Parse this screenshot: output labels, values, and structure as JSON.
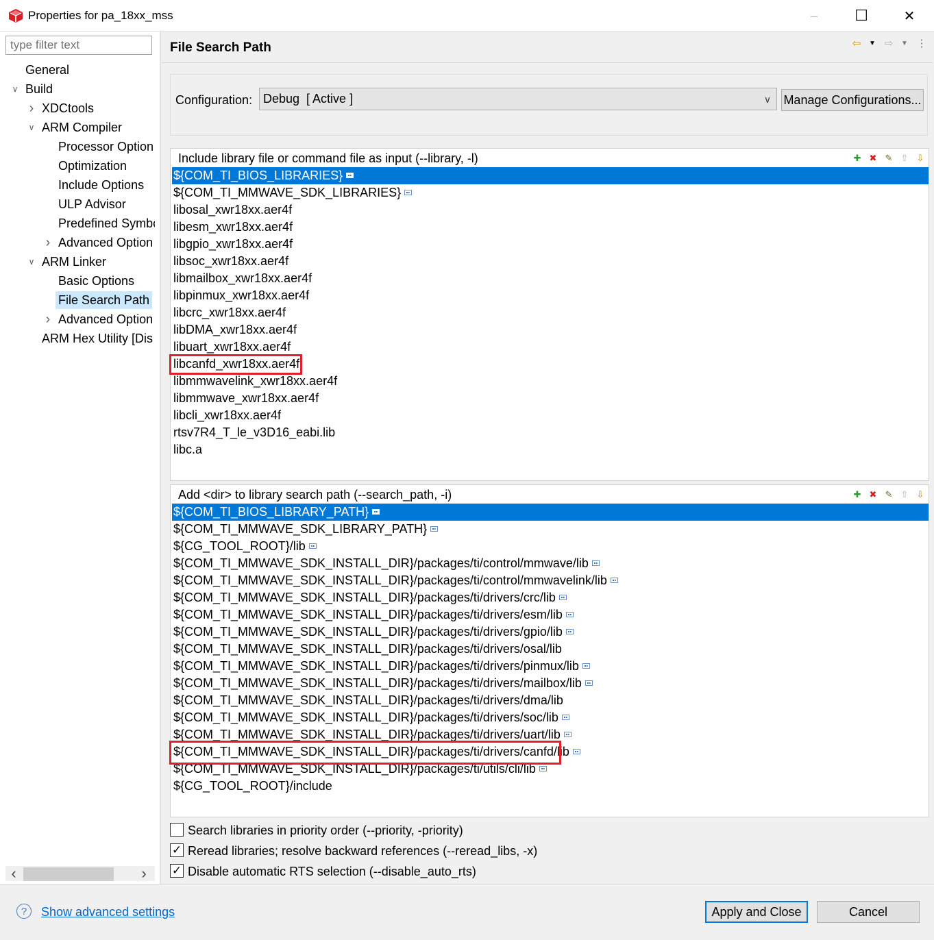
{
  "window": {
    "title": "Properties for pa_18xx_mss",
    "minimize_glyph": "–",
    "maximize_glyph": "☐",
    "close_glyph": "✕"
  },
  "filter": {
    "placeholder": "type filter text"
  },
  "tree": {
    "general": "General",
    "build": "Build",
    "xdctools": "XDCtools",
    "arm_compiler": "ARM Compiler",
    "processor_option": "Processor Option",
    "optimization": "Optimization",
    "include_options": "Include Options",
    "ulp_advisor": "ULP Advisor",
    "predefined_symbols": "Predefined Symbo",
    "advanced_options_compiler": "Advanced Option",
    "arm_linker": "ARM Linker",
    "basic_options": "Basic Options",
    "file_search_path": "File Search Path",
    "advanced_options_linker": "Advanced Option",
    "arm_hex_utility": "ARM Hex Utility  [Dis"
  },
  "page": {
    "title": "File Search Path"
  },
  "configuration": {
    "label": "Configuration:",
    "value": "Debug  [ Active ]",
    "manage_button": "Manage Configurations..."
  },
  "library_list": {
    "header": "Include library file or command file as input (--library, -l)",
    "items": [
      "${COM_TI_BIOS_LIBRARIES}",
      "${COM_TI_MMWAVE_SDK_LIBRARIES}",
      "libosal_xwr18xx.aer4f",
      "libesm_xwr18xx.aer4f",
      "libgpio_xwr18xx.aer4f",
      "libsoc_xwr18xx.aer4f",
      "libmailbox_xwr18xx.aer4f",
      "libpinmux_xwr18xx.aer4f",
      "libcrc_xwr18xx.aer4f",
      "libDMA_xwr18xx.aer4f",
      "libuart_xwr18xx.aer4f",
      "libcanfd_xwr18xx.aer4f",
      "libmmwavelink_xwr18xx.aer4f",
      "libmmwave_xwr18xx.aer4f",
      "libcli_xwr18xx.aer4f",
      "rtsv7R4_T_le_v3D16_eabi.lib",
      "libc.a"
    ]
  },
  "search_path_list": {
    "header": "Add <dir> to library search path (--search_path, -i)",
    "items": [
      "${COM_TI_BIOS_LIBRARY_PATH}",
      "${COM_TI_MMWAVE_SDK_LIBRARY_PATH}",
      "${CG_TOOL_ROOT}/lib",
      "${COM_TI_MMWAVE_SDK_INSTALL_DIR}/packages/ti/control/mmwave/lib",
      "${COM_TI_MMWAVE_SDK_INSTALL_DIR}/packages/ti/control/mmwavelink/lib",
      "${COM_TI_MMWAVE_SDK_INSTALL_DIR}/packages/ti/drivers/crc/lib",
      "${COM_TI_MMWAVE_SDK_INSTALL_DIR}/packages/ti/drivers/esm/lib",
      "${COM_TI_MMWAVE_SDK_INSTALL_DIR}/packages/ti/drivers/gpio/lib",
      "${COM_TI_MMWAVE_SDK_INSTALL_DIR}/packages/ti/drivers/osal/lib",
      "${COM_TI_MMWAVE_SDK_INSTALL_DIR}/packages/ti/drivers/pinmux/lib",
      "${COM_TI_MMWAVE_SDK_INSTALL_DIR}/packages/ti/drivers/mailbox/lib",
      "${COM_TI_MMWAVE_SDK_INSTALL_DIR}/packages/ti/drivers/dma/lib",
      "${COM_TI_MMWAVE_SDK_INSTALL_DIR}/packages/ti/drivers/soc/lib",
      "${COM_TI_MMWAVE_SDK_INSTALL_DIR}/packages/ti/drivers/uart/lib",
      "${COM_TI_MMWAVE_SDK_INSTALL_DIR}/packages/ti/drivers/canfd/lib",
      "${COM_TI_MMWAVE_SDK_INSTALL_DIR}/packages/ti/utils/cli/lib",
      "${CG_TOOL_ROOT}/include"
    ]
  },
  "options": {
    "priority": {
      "label": "Search libraries in priority order (--priority, -priority)",
      "checked": false
    },
    "reread": {
      "label": "Reread libraries; resolve backward references (--reread_libs, -x)",
      "checked": true
    },
    "disable_rts": {
      "label": "Disable automatic RTS selection (--disable_auto_rts)",
      "checked": true
    }
  },
  "footer": {
    "help_glyph": "?",
    "advanced_link": "Show advanced settings",
    "apply_close": "Apply and Close",
    "cancel": "Cancel"
  },
  "icons": {
    "check_glyph": "✓",
    "chevron_right": "›",
    "chevron_down": "∨",
    "scroll_left": "‹",
    "scroll_right": "›",
    "back_arrow": "⇦",
    "forward_arrow": "⇨",
    "dropdown": "▼",
    "menu": "⋮",
    "config_chevron": "∨"
  },
  "colors": {
    "selection": "#0078d7",
    "tree_selection": "#cce8ff",
    "highlight_box": "#e0202a",
    "link": "#0066cc"
  }
}
